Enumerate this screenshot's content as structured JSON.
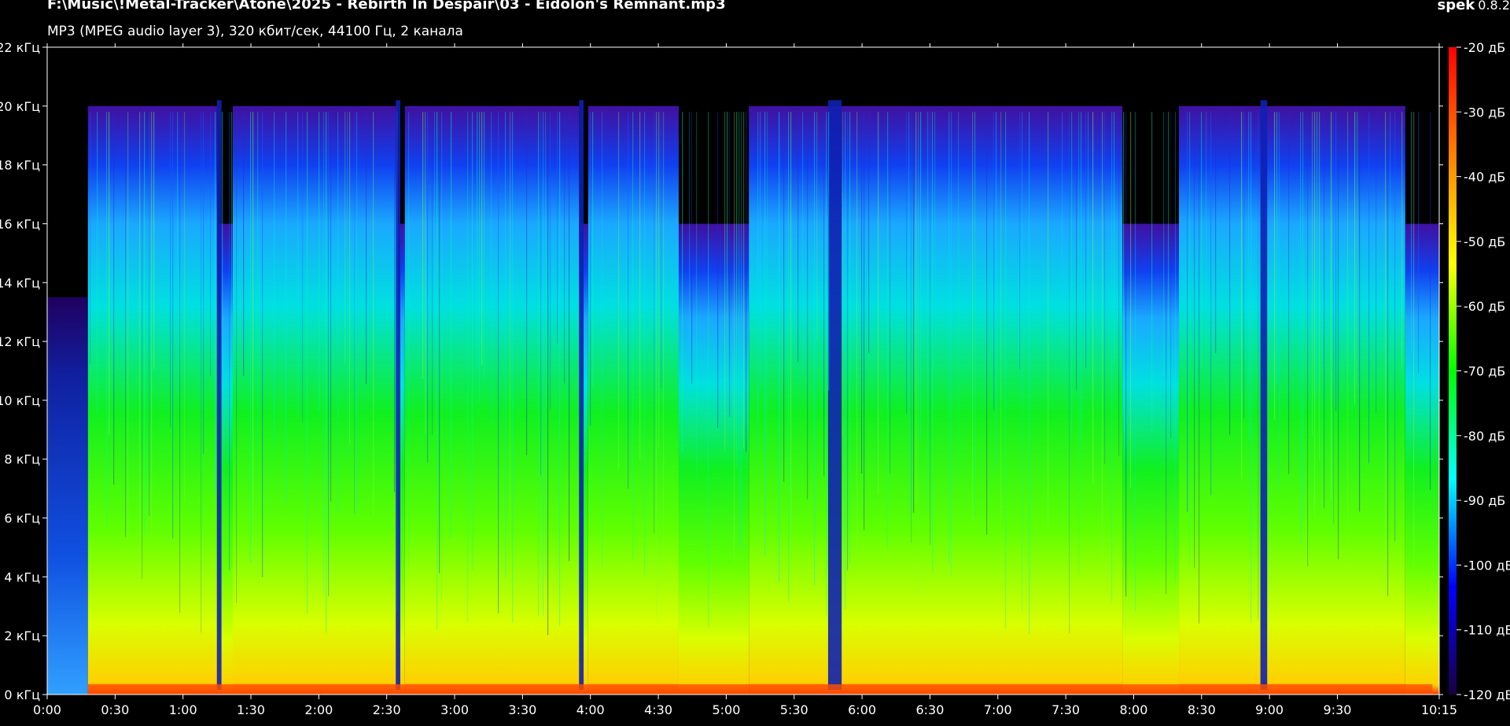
{
  "window": {
    "file_path": "F:\\Music\\!Metal-Tracker\\Atone\\2025 - Rebirth In Despair\\03 - Eidolon's Remnant.mp3",
    "audio_info": "MP3 (MPEG audio layer 3), 320 кбит/сек, 44100 Гц, 2 канала",
    "app_name": "spek",
    "app_version": "0.8.2"
  },
  "chart_data": {
    "type": "heatmap",
    "title": "F:\\Music\\!Metal-Tracker\\Atone\\2025 - Rebirth In Despair\\03 - Eidolon's Remnant.mp3",
    "subtitle": "MP3 (MPEG audio layer 3), 320 кбит/сек, 44100 Гц, 2 канала",
    "x": {
      "unit": "time",
      "range_seconds": [
        0,
        615
      ],
      "tick_seconds": [
        0,
        30,
        60,
        90,
        120,
        150,
        180,
        210,
        240,
        270,
        300,
        330,
        360,
        390,
        420,
        450,
        480,
        510,
        540,
        570,
        615
      ],
      "tick_labels": [
        "0:00",
        "0:30",
        "1:00",
        "1:30",
        "2:00",
        "2:30",
        "3:00",
        "3:30",
        "4:00",
        "4:30",
        "5:00",
        "5:30",
        "6:00",
        "6:30",
        "7:00",
        "7:30",
        "8:00",
        "8:30",
        "9:00",
        "9:30",
        "10:15"
      ]
    },
    "y": {
      "unit": "kHz",
      "range": [
        0,
        22
      ],
      "tick_values": [
        0,
        2,
        4,
        6,
        8,
        10,
        12,
        14,
        16,
        18,
        20,
        22
      ],
      "tick_labels": [
        "0 кГц",
        "2 кГц",
        "4 кГц",
        "6 кГц",
        "8 кГц",
        "10 кГц",
        "12 кГц",
        "14 кГц",
        "16 кГц",
        "18 кГц",
        "20 кГц",
        "22 кГц"
      ]
    },
    "colorbar": {
      "unit": "dB",
      "range": [
        -120,
        -20
      ],
      "tick_values": [
        -20,
        -30,
        -40,
        -50,
        -60,
        -70,
        -80,
        -90,
        -100,
        -110,
        -120
      ],
      "tick_labels": [
        "-20 дБ",
        "-30 дБ",
        "-40 дБ",
        "-50 дБ",
        "-60 дБ",
        "-70 дБ",
        "-80 дБ",
        "-90 дБ",
        "-100 дБ",
        "-110 дБ",
        "-120 дБ"
      ],
      "colors": [
        "#ff0000",
        "#ff8000",
        "#ffff00",
        "#00ff00",
        "#00ffff",
        "#0000ff",
        "#1a0040"
      ]
    },
    "approx_cutoff_khz_segments": [
      {
        "from_s": 0,
        "to_s": 18,
        "cutoff_khz": 13.5
      },
      {
        "from_s": 18,
        "to_s": 75,
        "cutoff_khz": 20
      },
      {
        "from_s": 75,
        "to_s": 82,
        "cutoff_khz": 16
      },
      {
        "from_s": 82,
        "to_s": 155,
        "cutoff_khz": 20
      },
      {
        "from_s": 155,
        "to_s": 158,
        "cutoff_khz": 16
      },
      {
        "from_s": 158,
        "to_s": 235,
        "cutoff_khz": 20
      },
      {
        "from_s": 235,
        "to_s": 239,
        "cutoff_khz": 16
      },
      {
        "from_s": 239,
        "to_s": 279,
        "cutoff_khz": 20
      },
      {
        "from_s": 279,
        "to_s": 310,
        "cutoff_khz": 16
      },
      {
        "from_s": 310,
        "to_s": 475,
        "cutoff_khz": 20
      },
      {
        "from_s": 475,
        "to_s": 500,
        "cutoff_khz": 16
      },
      {
        "from_s": 500,
        "to_s": 600,
        "cutoff_khz": 20
      },
      {
        "from_s": 600,
        "to_s": 615,
        "cutoff_khz": 16
      }
    ],
    "low_energy_gaps_s": [
      [
        75,
        77
      ],
      [
        154,
        156
      ],
      [
        235,
        237
      ],
      [
        345,
        351
      ],
      [
        536,
        539
      ]
    ],
    "grid": false,
    "legend": "colorbar right"
  }
}
